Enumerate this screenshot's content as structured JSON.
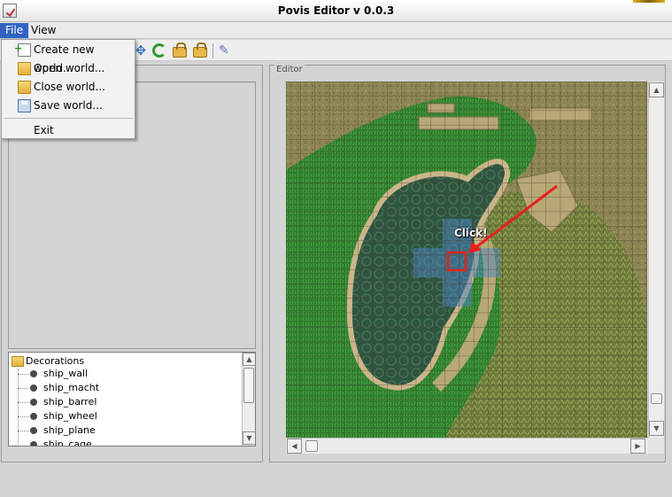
{
  "window": {
    "title": "Povis Editor v 0.0.3"
  },
  "menubar": {
    "file": "File",
    "view": "View"
  },
  "file_menu": {
    "items": [
      {
        "label": "Create new world...",
        "icon": "new-file-icon"
      },
      {
        "label": "Open world...",
        "icon": "open-folder-icon"
      },
      {
        "label": "Close world...",
        "icon": "close-folder-icon"
      },
      {
        "label": "Save world...",
        "icon": "save-icon"
      }
    ],
    "exit_label": "Exit"
  },
  "toolbar": {
    "icons": [
      "move-icon",
      "refresh-icon",
      "lock-icon",
      "unlock-icon",
      "paint-icon"
    ]
  },
  "editor": {
    "legend": "Editor",
    "annotation": "Click!"
  },
  "tree": {
    "root": "Decorations",
    "items": [
      "ship_wall",
      "ship_macht",
      "ship_barrel",
      "ship_wheel",
      "ship_plane",
      "ship_cage"
    ]
  },
  "colors": {
    "menu_highlight": "#3163c4",
    "annotation": "#e8201a",
    "selection": "#4f86c6"
  }
}
